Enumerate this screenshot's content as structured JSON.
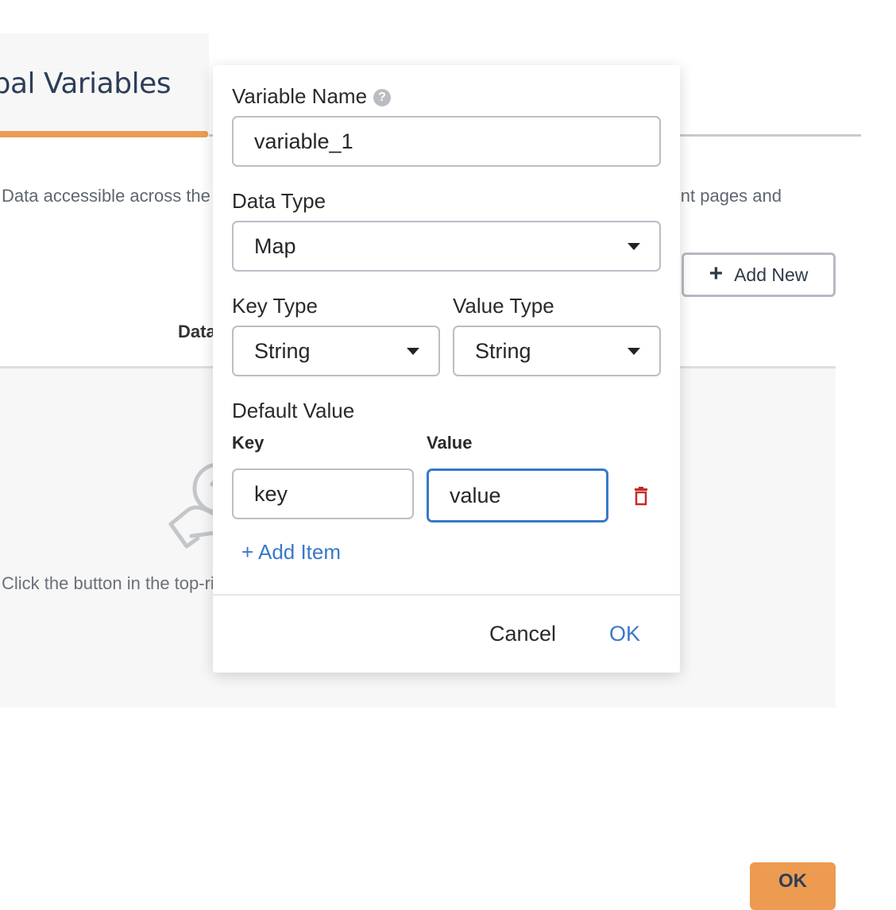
{
  "background": {
    "tab_title": "Global Variables",
    "description_left": "Data accessible across the entire application",
    "description_right": "ent pages and",
    "add_new_label": "Add New",
    "column_header_data_type": "Data Type",
    "empty_state_text": "Click the button in the top-right",
    "footer_ok_label": "OK",
    "accent_color": "#ec9b51"
  },
  "modal": {
    "variable_name_label": "Variable Name",
    "variable_name_value": "variable_1",
    "data_type_label": "Data Type",
    "data_type_value": "Map",
    "key_type_label": "Key Type",
    "key_type_value": "String",
    "value_type_label": "Value Type",
    "value_type_value": "String",
    "default_value_label": "Default Value",
    "key_column_label": "Key",
    "value_column_label": "Value",
    "items": [
      {
        "key": "key",
        "value": "value"
      }
    ],
    "add_item_label": "+ Add Item",
    "cancel_label": "Cancel",
    "ok_label": "OK",
    "link_color": "#3a78c9",
    "delete_color": "#c62828"
  }
}
